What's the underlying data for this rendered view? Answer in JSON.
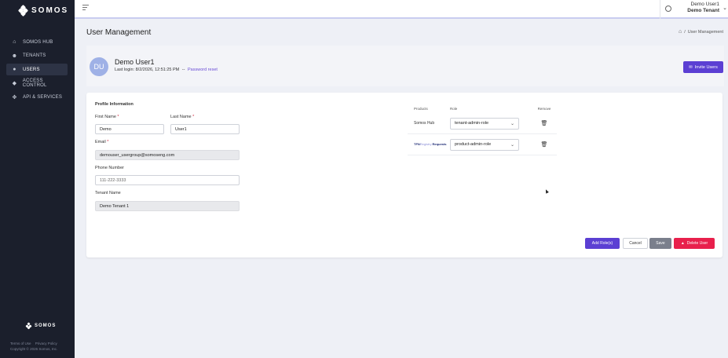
{
  "brand": {
    "name": "SOMOS"
  },
  "sidebar": {
    "items": [
      {
        "label": "SOMOS HUB",
        "icon": "home-icon"
      },
      {
        "label": "TENANTS",
        "icon": "users-icon"
      },
      {
        "label": "USERS",
        "icon": "user-icon",
        "active": true
      },
      {
        "label": "ACCESS CONTROL",
        "icon": "shield-icon"
      },
      {
        "label": "API & SERVICES",
        "icon": "api-icon"
      }
    ],
    "footer": {
      "brand": "SOMOS",
      "terms": "Terms of Use",
      "privacy": "Privacy Policy",
      "copyright": "Copyright © 2026 Somos, Inc."
    }
  },
  "topbar": {
    "user_name": "Demo User1",
    "tenant_name": "Demo Tenant"
  },
  "page": {
    "title": "User Management",
    "breadcrumb_sep": "/",
    "breadcrumb_current": "User Management"
  },
  "user": {
    "initials": "DU",
    "name": "Demo User1",
    "last_login_label": "Last login:",
    "last_login": "8/2/2026, 12:51:25 PM",
    "separator": "--",
    "password_reset": "Password reset",
    "invite_label": "Invite Users"
  },
  "profile": {
    "section_title": "Profile Information",
    "first_name_label": "First Name",
    "first_name": "Demo",
    "last_name_label": "Last Name",
    "last_name": "User1",
    "email_label": "Email",
    "email": "demouser_usergroup@somoseng.com",
    "phone_label": "Phone Number",
    "phone_placeholder": "111-222-3333",
    "tenant_label": "Tenant Name",
    "tenant": "Demo Tenant 1",
    "required_mark": "*"
  },
  "products": {
    "headers": {
      "product": "Products",
      "role": "Role",
      "remove": "Remove"
    },
    "rows": [
      {
        "product": "Somos Hub",
        "role": "tenant-admin-role"
      },
      {
        "product_prefix": "TFN",
        "product_mid": "Registry",
        "product_suffix": "Requests",
        "role": "product-admin-role"
      }
    ]
  },
  "actions": {
    "add_role": "Add Role(s)",
    "cancel": "Cancel",
    "save": "Save",
    "delete_user": "Delete User"
  },
  "colors": {
    "sidebar_bg": "#1b1f2c",
    "primary": "#5b3fd3",
    "danger": "#e8204c",
    "avatar": "#9fb1e6"
  }
}
